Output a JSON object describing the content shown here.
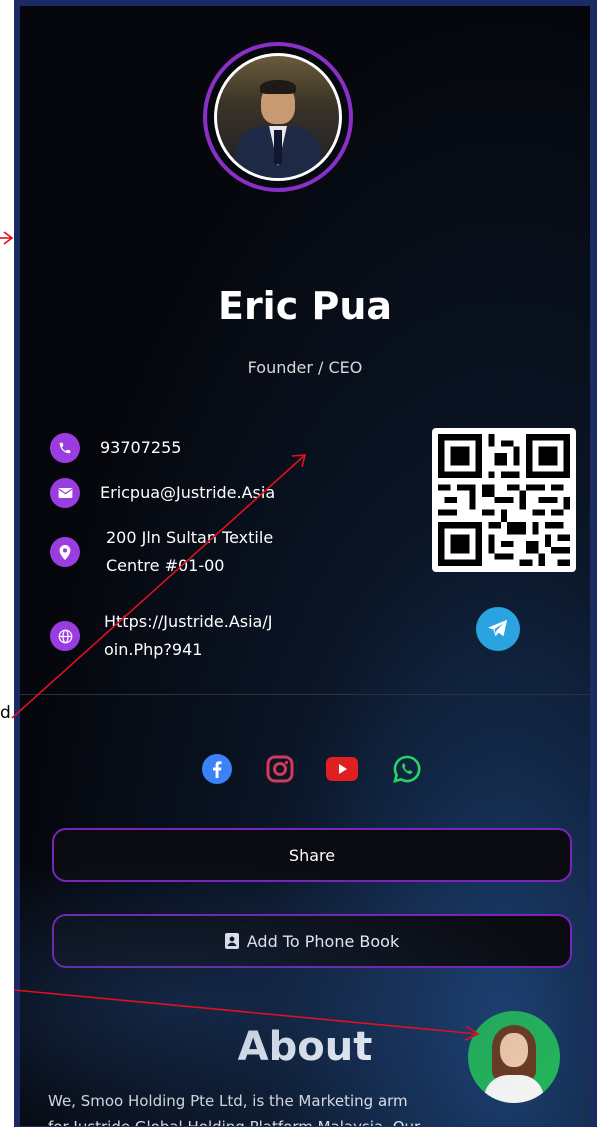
{
  "profile": {
    "name": "Eric Pua",
    "role": "Founder / CEO"
  },
  "contacts": [
    {
      "icon": "phone-icon",
      "text": "93707255"
    },
    {
      "icon": "email-icon",
      "text": "Ericpua@Justride.Asia"
    },
    {
      "icon": "location-icon",
      "lines": [
        "200 Jln Sultan Textile",
        "Centre #01-00"
      ]
    },
    {
      "icon": "globe-icon",
      "lines": [
        "Https://Justride.Asia/J",
        "oin.Php?941"
      ]
    }
  ],
  "social": [
    {
      "icon": "facebook-icon",
      "color": "#3b82f6"
    },
    {
      "icon": "instagram-icon",
      "color": "#d23a5a"
    },
    {
      "icon": "youtube-icon",
      "color": "#e02020"
    },
    {
      "icon": "whatsapp-icon",
      "color": "#25d366"
    }
  ],
  "buttons": {
    "share": "Share",
    "add_phone_book": "Add To Phone Book"
  },
  "about": {
    "title": "About",
    "text_line1": "We, Smoo Holding Pte Ltd, is the Marketing arm",
    "text_line2": "for Justride Global Holding Platform Malaysia. Our"
  },
  "annotation": {
    "left_char": "d"
  },
  "colors": {
    "accent": "#9b3ce0",
    "frame": "#1c2a63",
    "annotation_arrow": "#e01020"
  }
}
